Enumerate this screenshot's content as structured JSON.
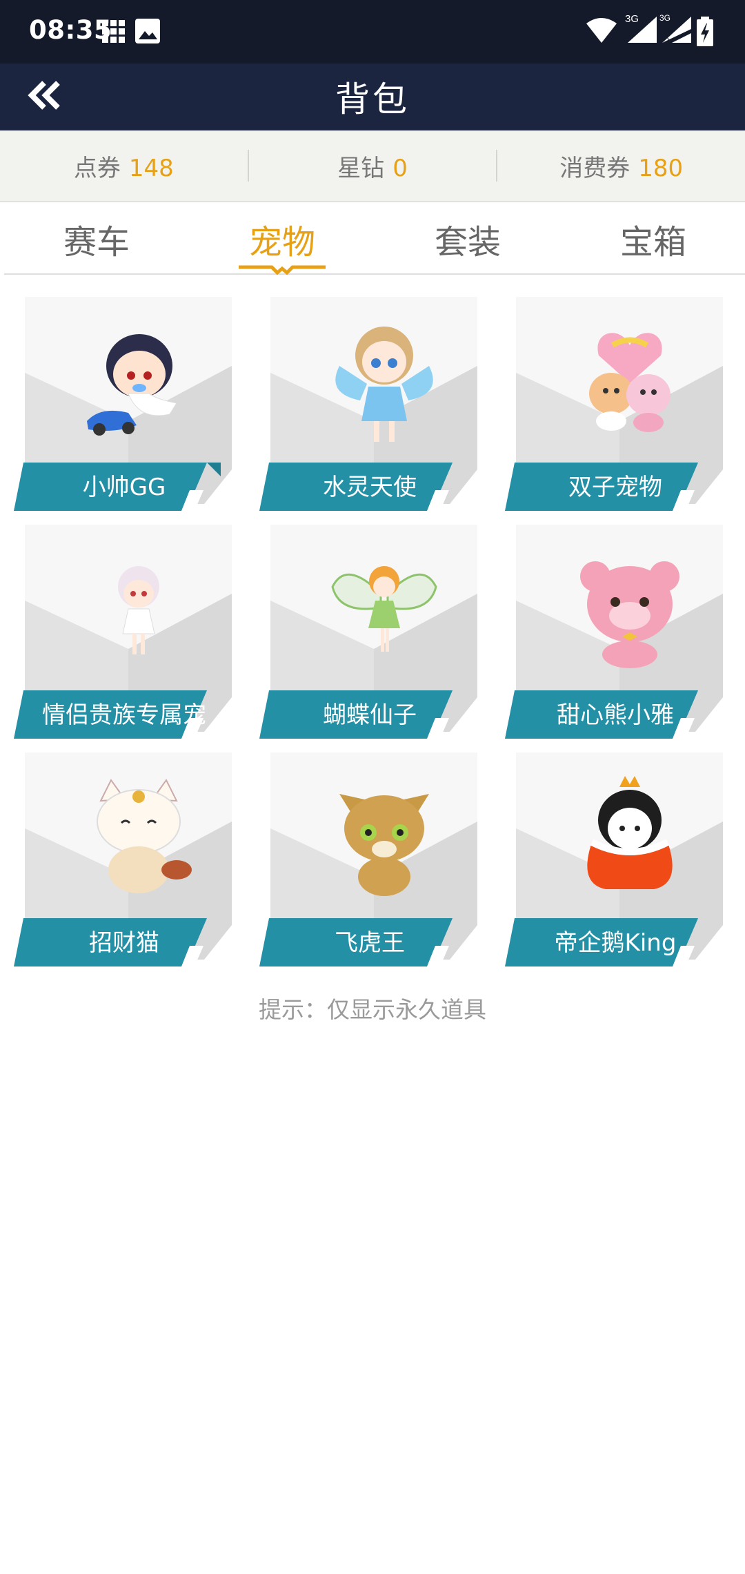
{
  "status_bar": {
    "time": "08:35",
    "network_3g": "3G",
    "network_3g_1x": "3G 1X"
  },
  "header": {
    "title": "背包",
    "back_icon": "double-chevron-left-icon"
  },
  "currency": [
    {
      "label": "点券",
      "value": "148"
    },
    {
      "label": "星钻",
      "value": "0"
    },
    {
      "label": "消费券",
      "value": "180"
    }
  ],
  "tabs": [
    {
      "label": "赛车",
      "active": false
    },
    {
      "label": "宠物",
      "active": true
    },
    {
      "label": "套装",
      "active": false
    },
    {
      "label": "宝箱",
      "active": false
    }
  ],
  "pets": [
    {
      "name": "小帅GG",
      "icon": "boy-with-toy-car-icon"
    },
    {
      "name": "水灵天使",
      "icon": "angel-girl-icon"
    },
    {
      "name": "双子宠物",
      "icon": "twin-pets-icon"
    },
    {
      "name": "情侣贵族专属宠",
      "icon": "noble-girl-icon"
    },
    {
      "name": "蝴蝶仙子",
      "icon": "butterfly-fairy-icon"
    },
    {
      "name": "甜心熊小雅",
      "icon": "pink-bear-icon"
    },
    {
      "name": "招财猫",
      "icon": "lucky-cat-icon"
    },
    {
      "name": "飞虎王",
      "icon": "tiger-cub-icon"
    },
    {
      "name": "帝企鹅King",
      "icon": "penguin-king-icon"
    }
  ],
  "hint": "提示：仅显示永久道具",
  "colors": {
    "accent": "#e6a117",
    "header_bg": "#1c2540",
    "status_bg": "#151a2a",
    "banner": "#2390a6"
  }
}
